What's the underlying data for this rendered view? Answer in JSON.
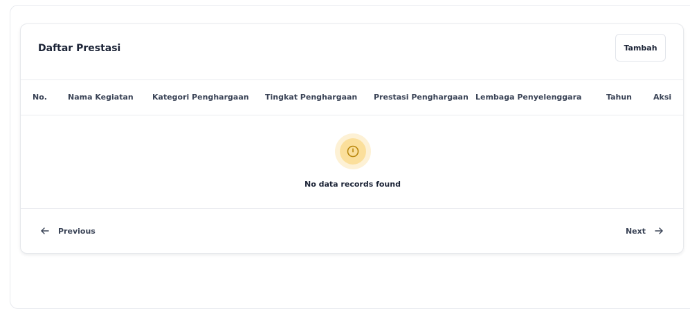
{
  "card": {
    "title": "Daftar Prestasi",
    "add_button_label": "Tambah"
  },
  "table": {
    "columns": [
      "No.",
      "Nama Kegiatan",
      "Kategori Penghargaan",
      "Tingkat Penghargaan",
      "Prestasi Penghargaan",
      "Lembaga Penyelenggara",
      "Tahun",
      "Aksi"
    ],
    "rows": [],
    "empty_message": "No data records found",
    "empty_icon": "info-circle-icon"
  },
  "pagination": {
    "previous_label": "Previous",
    "next_label": "Next",
    "previous_icon": "arrow-left-icon",
    "next_icon": "arrow-right-icon"
  },
  "colors": {
    "icon_halo": "#fdf1d5",
    "icon_ring": "#fbdf9b",
    "icon_stroke": "#b8860b",
    "text_dark": "#1b2336"
  }
}
